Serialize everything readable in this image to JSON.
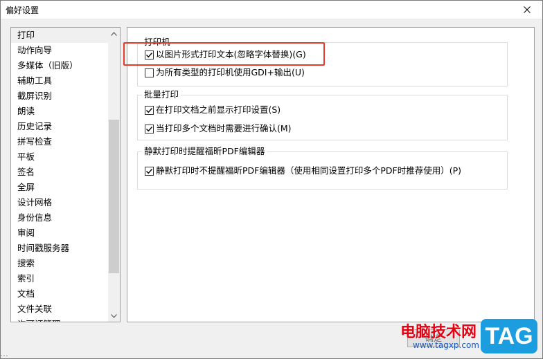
{
  "window": {
    "title": "偏好设置",
    "close_glyph": "✕"
  },
  "nav": {
    "items": [
      {
        "label": "打印",
        "selected": true
      },
      {
        "label": "动作向导"
      },
      {
        "label": "多媒体（旧版）"
      },
      {
        "label": "辅助工具"
      },
      {
        "label": "截屏识别"
      },
      {
        "label": "朗读"
      },
      {
        "label": "历史记录"
      },
      {
        "label": "拼写检查"
      },
      {
        "label": "平板"
      },
      {
        "label": "签名"
      },
      {
        "label": "全屏"
      },
      {
        "label": "设计网格"
      },
      {
        "label": "身份信息"
      },
      {
        "label": "审阅"
      },
      {
        "label": "时间戳服务器"
      },
      {
        "label": "搜索"
      },
      {
        "label": "索引"
      },
      {
        "label": "文档"
      },
      {
        "label": "文件关联"
      },
      {
        "label": "许可证管理"
      }
    ]
  },
  "groups": {
    "printer": {
      "title": "打印机",
      "options": [
        {
          "label": "以图片形式打印文本(忽略字体替换)(G)",
          "checked": true
        },
        {
          "label": "为所有类型的打印机使用GDI+输出(U)",
          "checked": false
        }
      ]
    },
    "batch": {
      "title": "批量打印",
      "options": [
        {
          "label": "在打印文档之前显示打印设置(S)",
          "checked": true
        },
        {
          "label": "当打印多个文档时需要进行确认(M)",
          "checked": true
        }
      ]
    },
    "silent": {
      "title": "静默打印时提醒福昕PDF编辑器",
      "options": [
        {
          "label": "静默打印时不提醒福昕PDF编辑器（使用相同设置打印多个PDF时推荐使用）(P)",
          "checked": true
        }
      ]
    }
  },
  "footer": {
    "ok_label": "确定",
    "watermark_title": "电脑技术网",
    "watermark_url": "www.tagxp.com",
    "tag_logo": "TAG",
    "bottom_text": "…"
  },
  "colors": {
    "highlight": "#e53a2c",
    "tag_blue": "#1b9de0",
    "watermark_red": "#e60012"
  }
}
